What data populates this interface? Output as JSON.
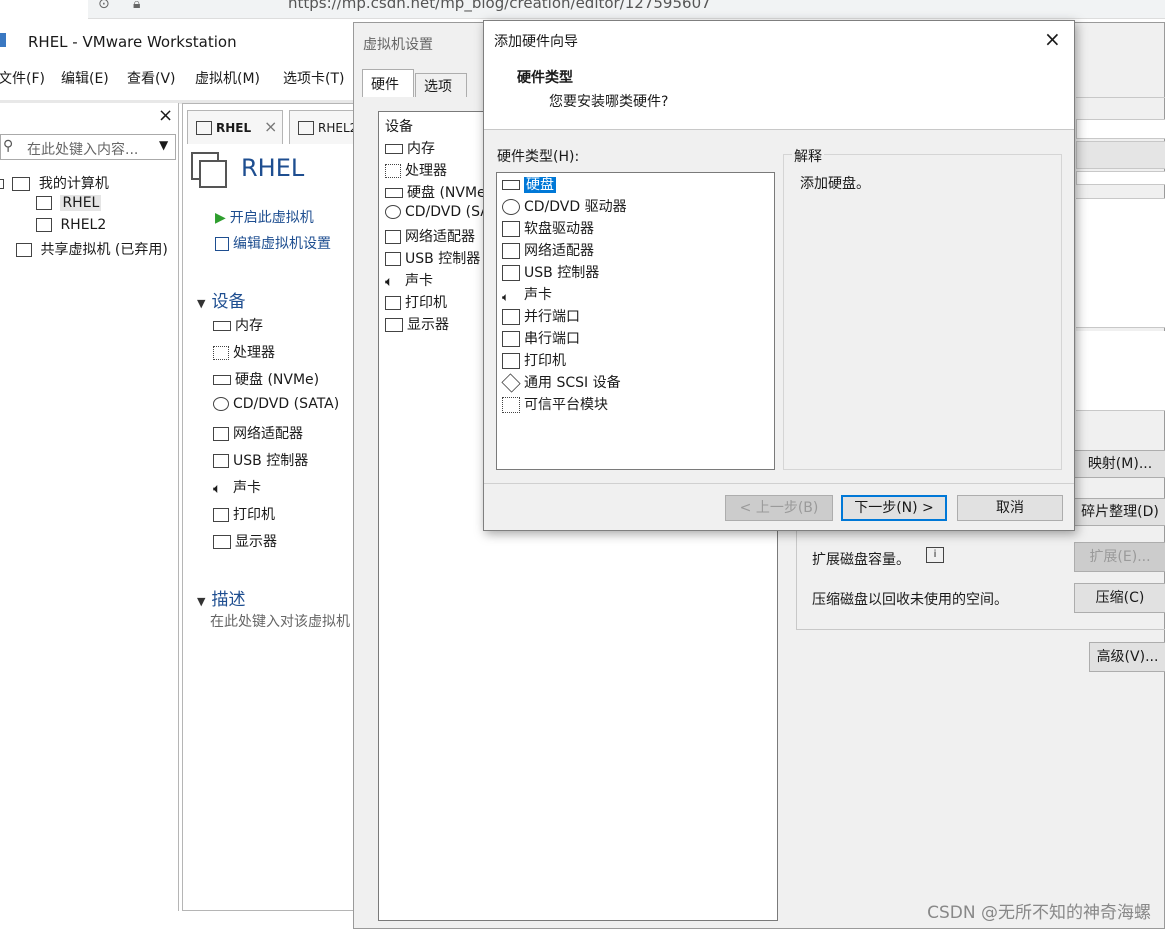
{
  "browser": {
    "url": "https://mp.csdn.net/mp_blog/creation/editor/127595607"
  },
  "window": {
    "title": "RHEL - VMware Workstation"
  },
  "menu": [
    "文件(F)",
    "编辑(E)",
    "查看(V)",
    "虚拟机(M)",
    "选项卡(T)"
  ],
  "library": {
    "search_placeholder": "在此处键入内容...",
    "close": "×",
    "tree": {
      "root": "我的计算机",
      "vms": [
        "RHEL",
        "RHEL2"
      ],
      "shared": "共享虚拟机 (已弃用)"
    }
  },
  "vm_tabs": [
    {
      "label": "RHEL",
      "close": "×"
    },
    {
      "label": "RHEL2"
    }
  ],
  "vm": {
    "name": "RHEL",
    "actions": [
      "开启此虚拟机",
      "编辑虚拟机设置"
    ],
    "devices_title": "设备",
    "devices": [
      "内存",
      "处理器",
      "硬盘 (NVMe)",
      "CD/DVD (SATA)",
      "网络适配器",
      "USB 控制器",
      "声卡",
      "打印机",
      "显示器"
    ],
    "desc_title": "描述",
    "desc_placeholder": "在此处键入对该虚拟机"
  },
  "settings": {
    "title": "虚拟机设置",
    "tabs": [
      "硬件",
      "选项"
    ],
    "list_header": "设备",
    "devices": [
      "内存",
      "处理器",
      "硬盘 (NVMe",
      "CD/DVD (SA",
      "网络适配器",
      "USB 控制器",
      "声卡",
      "打印机",
      "显示器"
    ],
    "buttons": {
      "map": "映射(M)...",
      "defrag": "碎片整理(D)",
      "expand": "扩展(E)...",
      "compact": "压缩(C)",
      "advanced": "高级(V)..."
    },
    "expand_text": "扩展磁盘容量。",
    "compact_text": "压缩磁盘以回收未使用的空间。"
  },
  "wizard": {
    "title": "添加硬件向导",
    "close": "×",
    "header_title": "硬件类型",
    "header_subtitle": "您要安装哪类硬件?",
    "list_label": "硬件类型(H):",
    "items": [
      "硬盘",
      "CD/DVD 驱动器",
      "软盘驱动器",
      "网络适配器",
      "USB 控制器",
      "声卡",
      "并行端口",
      "串行端口",
      "打印机",
      "通用 SCSI 设备",
      "可信平台模块"
    ],
    "selected_index": 0,
    "explanation_label": "解释",
    "explanation_text": "添加硬盘。",
    "buttons": {
      "back": "< 上一步(B)",
      "next": "下一步(N) >",
      "cancel": "取消"
    }
  },
  "watermark": "CSDN @无所不知的神奇海螺",
  "colors": {
    "accent": "#0078d7",
    "link": "#1e4e90",
    "play": "#2e9e2e"
  }
}
